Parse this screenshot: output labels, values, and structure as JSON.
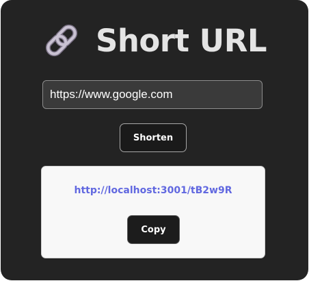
{
  "header": {
    "icon": "link-icon",
    "title": "Short URL"
  },
  "form": {
    "url_value": "https://www.google.com",
    "shorten_label": "Shorten"
  },
  "result": {
    "short_url": "http://localhost:3001/tB2w9R",
    "copy_label": "Copy"
  },
  "colors": {
    "background": "#232323",
    "title": "#e4e4e4",
    "link": "#6168e0",
    "result_panel": "#f8f8f8",
    "button": "#1a1a1a"
  }
}
